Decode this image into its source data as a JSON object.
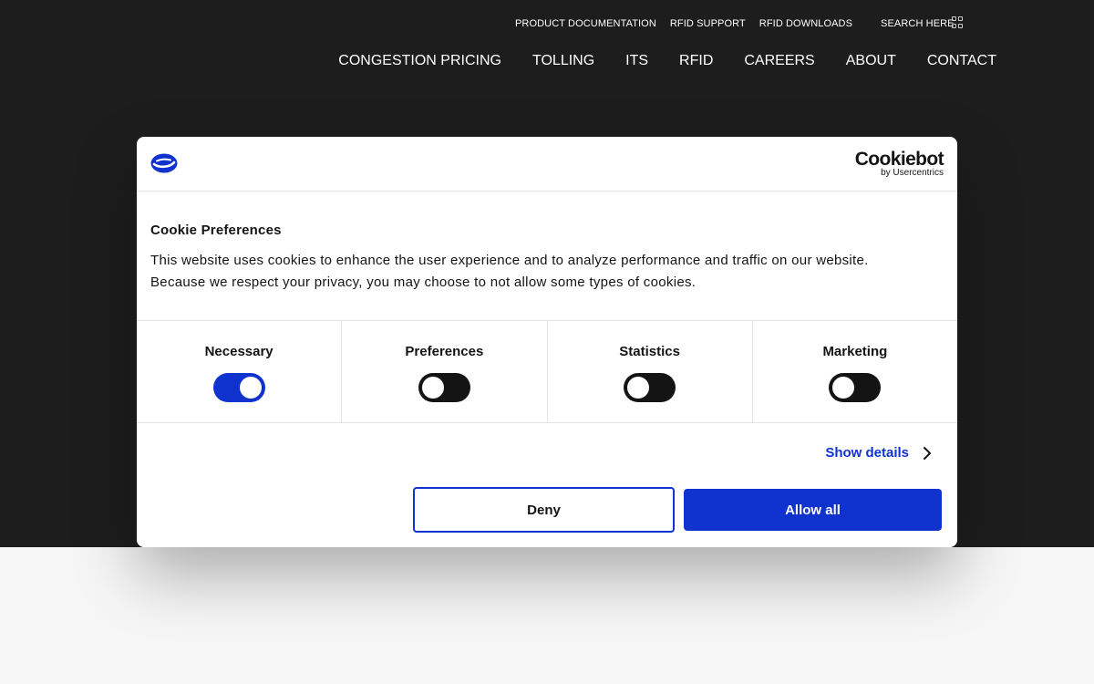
{
  "utility_nav": {
    "items": [
      "PRODUCT DOCUMENTATION",
      "RFID SUPPORT",
      "RFID DOWNLOADS"
    ],
    "search_label": "SEARCH HERE"
  },
  "main_nav": {
    "items": [
      "CONGESTION PRICING",
      "TOLLING",
      "ITS",
      "RFID",
      "CAREERS",
      "ABOUT",
      "CONTACT"
    ]
  },
  "cookie_dialog": {
    "brand_name": "Cookiebot",
    "brand_sub": "by Usercentrics",
    "title": "Cookie Preferences",
    "text_line1": "This website uses cookies to enhance the user experience and to analyze performance and traffic on our website.",
    "text_line2": "Because we respect your privacy, you may choose to not allow some types of cookies.",
    "categories": [
      {
        "label": "Necessary",
        "enabled": true
      },
      {
        "label": "Preferences",
        "enabled": false
      },
      {
        "label": "Statistics",
        "enabled": false
      },
      {
        "label": "Marketing",
        "enabled": false
      }
    ],
    "show_details_label": "Show details",
    "deny_label": "Deny",
    "allow_all_label": "Allow all"
  },
  "colors": {
    "header_bg": "#1d1d1d",
    "accent_blue": "#1032cf",
    "page_bg": "#f6f6f6",
    "toggle_off": "#141414"
  },
  "icons": {
    "utility": "grid-icon",
    "logo": "cookiebot-logo-mark",
    "details": "chevron-right-icon"
  }
}
